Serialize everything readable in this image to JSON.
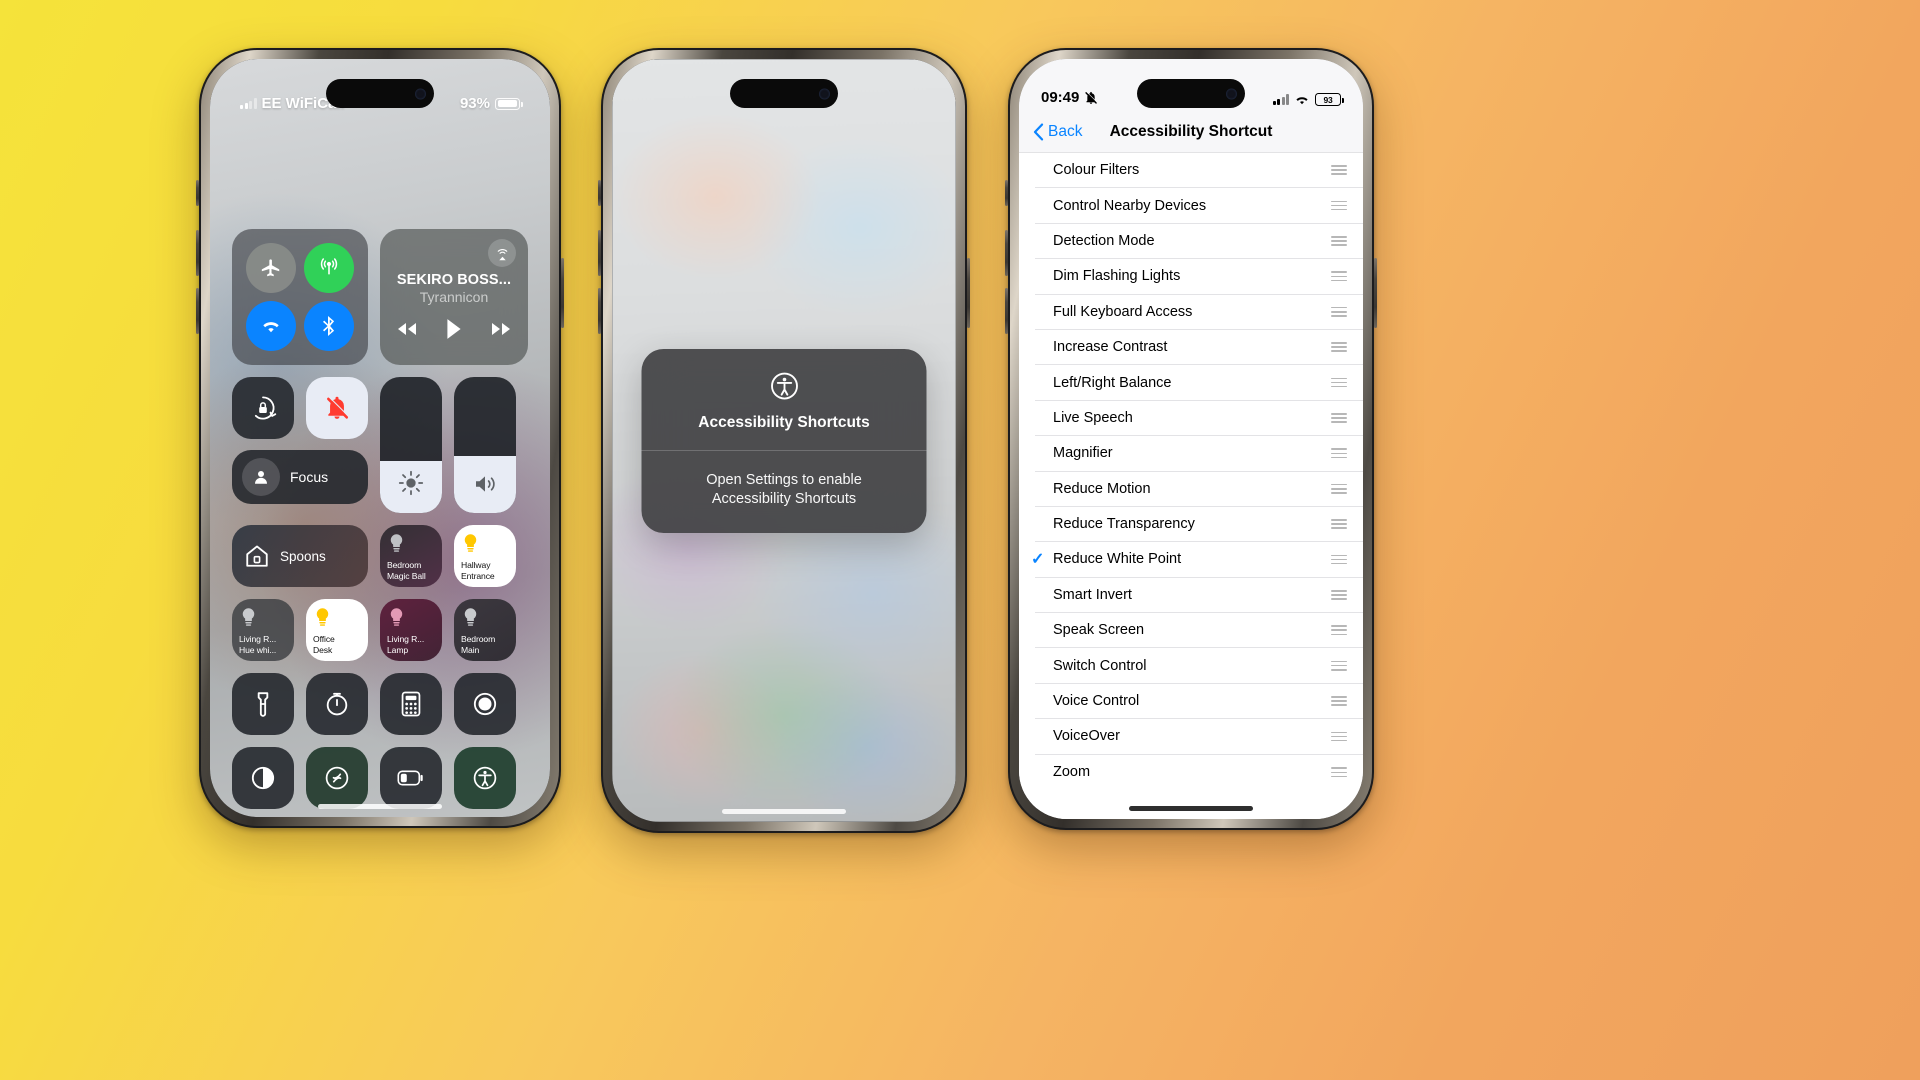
{
  "phone1": {
    "status": {
      "carrier": "EE WiFiCall",
      "battery_percent": "93%",
      "signal_icon": "cellular-bars-icon",
      "wifi_icon": "wifi-icon",
      "battery_icon": "battery-icon"
    },
    "connectivity": [
      {
        "name": "airplane-mode",
        "icon": "airplane-icon",
        "state": "off"
      },
      {
        "name": "cellular-data",
        "icon": "cellular-antenna-icon",
        "state": "on"
      },
      {
        "name": "wifi",
        "icon": "wifi-icon",
        "state": "on"
      },
      {
        "name": "bluetooth",
        "icon": "bluetooth-icon",
        "state": "on"
      }
    ],
    "media": {
      "title": "SEKIRO BOSS...",
      "artist": "Tyrannicon",
      "airplay_icon": "airplay-audio-icon",
      "prev_icon": "rewind-icon",
      "play_icon": "play-icon",
      "next_icon": "fast-forward-icon"
    },
    "toggles": [
      {
        "name": "rotation-lock",
        "icon": "rotation-lock-icon",
        "state": "off"
      },
      {
        "name": "silent-mode",
        "icon": "bell-slash-icon",
        "state": "on"
      }
    ],
    "focus": {
      "label": "Focus",
      "icon": "person-icon"
    },
    "brightness": {
      "name": "brightness-slider",
      "icon": "sun-icon",
      "value": 38
    },
    "volume": {
      "name": "volume-slider",
      "icon": "speaker-icon",
      "value": 42
    },
    "home_scene": {
      "label": "Spoons",
      "icon": "home-icon"
    },
    "lights_row1": [
      {
        "label1": "Bedroom",
        "label2": "Magic Ball",
        "state": "off",
        "icon": "bulb-icon"
      },
      {
        "label1": "Hallway",
        "label2": "Entrance",
        "state": "on",
        "icon": "bulb-icon"
      }
    ],
    "lights_row2": [
      {
        "label1": "Living R...",
        "label2": "Hue whi...",
        "state": "off",
        "icon": "bulb-icon"
      },
      {
        "label1": "Office",
        "label2": "Desk",
        "state": "on",
        "icon": "bulb-icon"
      },
      {
        "label1": "Living R...",
        "label2": "Lamp",
        "state": "off",
        "icon": "bulb-icon"
      },
      {
        "label1": "Bedroom",
        "label2": "Main",
        "state": "off",
        "icon": "bulb-icon"
      }
    ],
    "utilities_row1": [
      {
        "name": "flashlight",
        "icon": "flashlight-icon"
      },
      {
        "name": "timer",
        "icon": "timer-icon"
      },
      {
        "name": "calculator",
        "icon": "calculator-icon"
      },
      {
        "name": "screen-record",
        "icon": "record-icon"
      }
    ],
    "utilities_row2": [
      {
        "name": "dark-mode",
        "icon": "contrast-circle-icon"
      },
      {
        "name": "shazam",
        "icon": "shazam-icon"
      },
      {
        "name": "low-power-mode",
        "icon": "battery-low-icon"
      },
      {
        "name": "accessibility-shortcuts",
        "icon": "accessibility-icon"
      }
    ]
  },
  "phone2": {
    "alert": {
      "title": "Accessibility Shortcuts",
      "message": "Open Settings to enable\nAccessibility Shortcuts",
      "icon": "accessibility-icon"
    }
  },
  "phone3": {
    "status": {
      "time": "09:49",
      "mute_icon": "bell-slash-icon",
      "signal_icon": "cellular-bars-icon",
      "wifi_icon": "wifi-icon",
      "battery_percent": "93"
    },
    "nav": {
      "back_label": "Back",
      "back_icon": "chevron-left-icon",
      "title": "Accessibility Shortcut"
    },
    "list": [
      {
        "label": "Colour Filters",
        "selected": false
      },
      {
        "label": "Control Nearby Devices",
        "selected": false
      },
      {
        "label": "Detection Mode",
        "selected": false
      },
      {
        "label": "Dim Flashing Lights",
        "selected": false
      },
      {
        "label": "Full Keyboard Access",
        "selected": false
      },
      {
        "label": "Increase Contrast",
        "selected": false
      },
      {
        "label": "Left/Right Balance",
        "selected": false
      },
      {
        "label": "Live Speech",
        "selected": false
      },
      {
        "label": "Magnifier",
        "selected": false
      },
      {
        "label": "Reduce Motion",
        "selected": false
      },
      {
        "label": "Reduce Transparency",
        "selected": false
      },
      {
        "label": "Reduce White Point",
        "selected": true
      },
      {
        "label": "Smart Invert",
        "selected": false
      },
      {
        "label": "Speak Screen",
        "selected": false
      },
      {
        "label": "Switch Control",
        "selected": false
      },
      {
        "label": "Voice Control",
        "selected": false
      },
      {
        "label": "VoiceOver",
        "selected": false
      },
      {
        "label": "Zoom",
        "selected": false
      }
    ],
    "reorder_icon": "drag-handle-icon",
    "check_icon": "checkmark-icon",
    "accent_color": "#0a84ff"
  }
}
